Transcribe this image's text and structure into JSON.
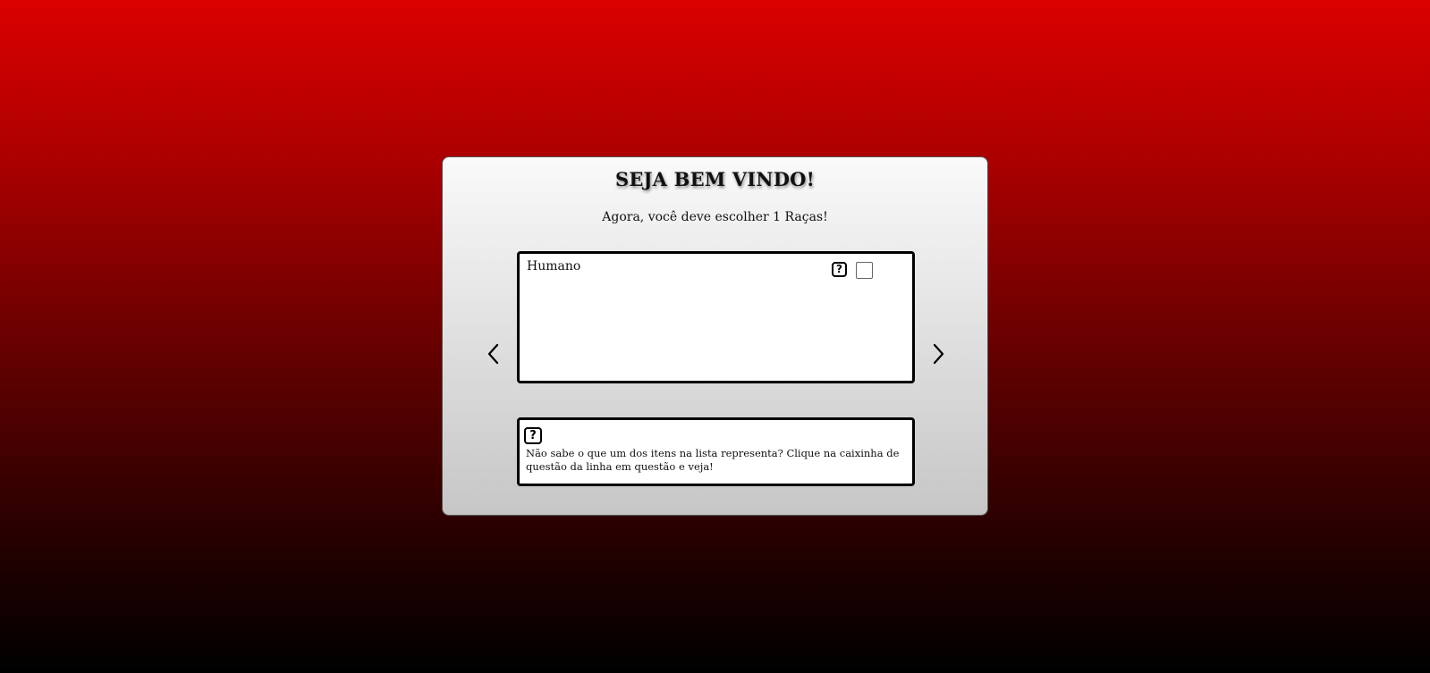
{
  "welcome": {
    "title": "SEJA BEM VINDO!",
    "subtitle": "Agora, você deve escolher 1 Raças!"
  },
  "race_list": {
    "items": [
      {
        "label": "Humano",
        "help_glyph": "?",
        "checked": false
      }
    ]
  },
  "navigation": {
    "prev_icon": "chevron-left-icon",
    "next_icon": "chevron-right-icon"
  },
  "info": {
    "help_glyph": "?",
    "text": "Não sabe o que um dos itens na lista representa? Clique na caixinha de questão da linha em questão e veja!"
  },
  "colors": {
    "background_top": "#dc0000",
    "background_bottom": "#000000",
    "card_top": "#fafafa",
    "card_bottom": "#c6c6c6",
    "border": "#000000"
  }
}
